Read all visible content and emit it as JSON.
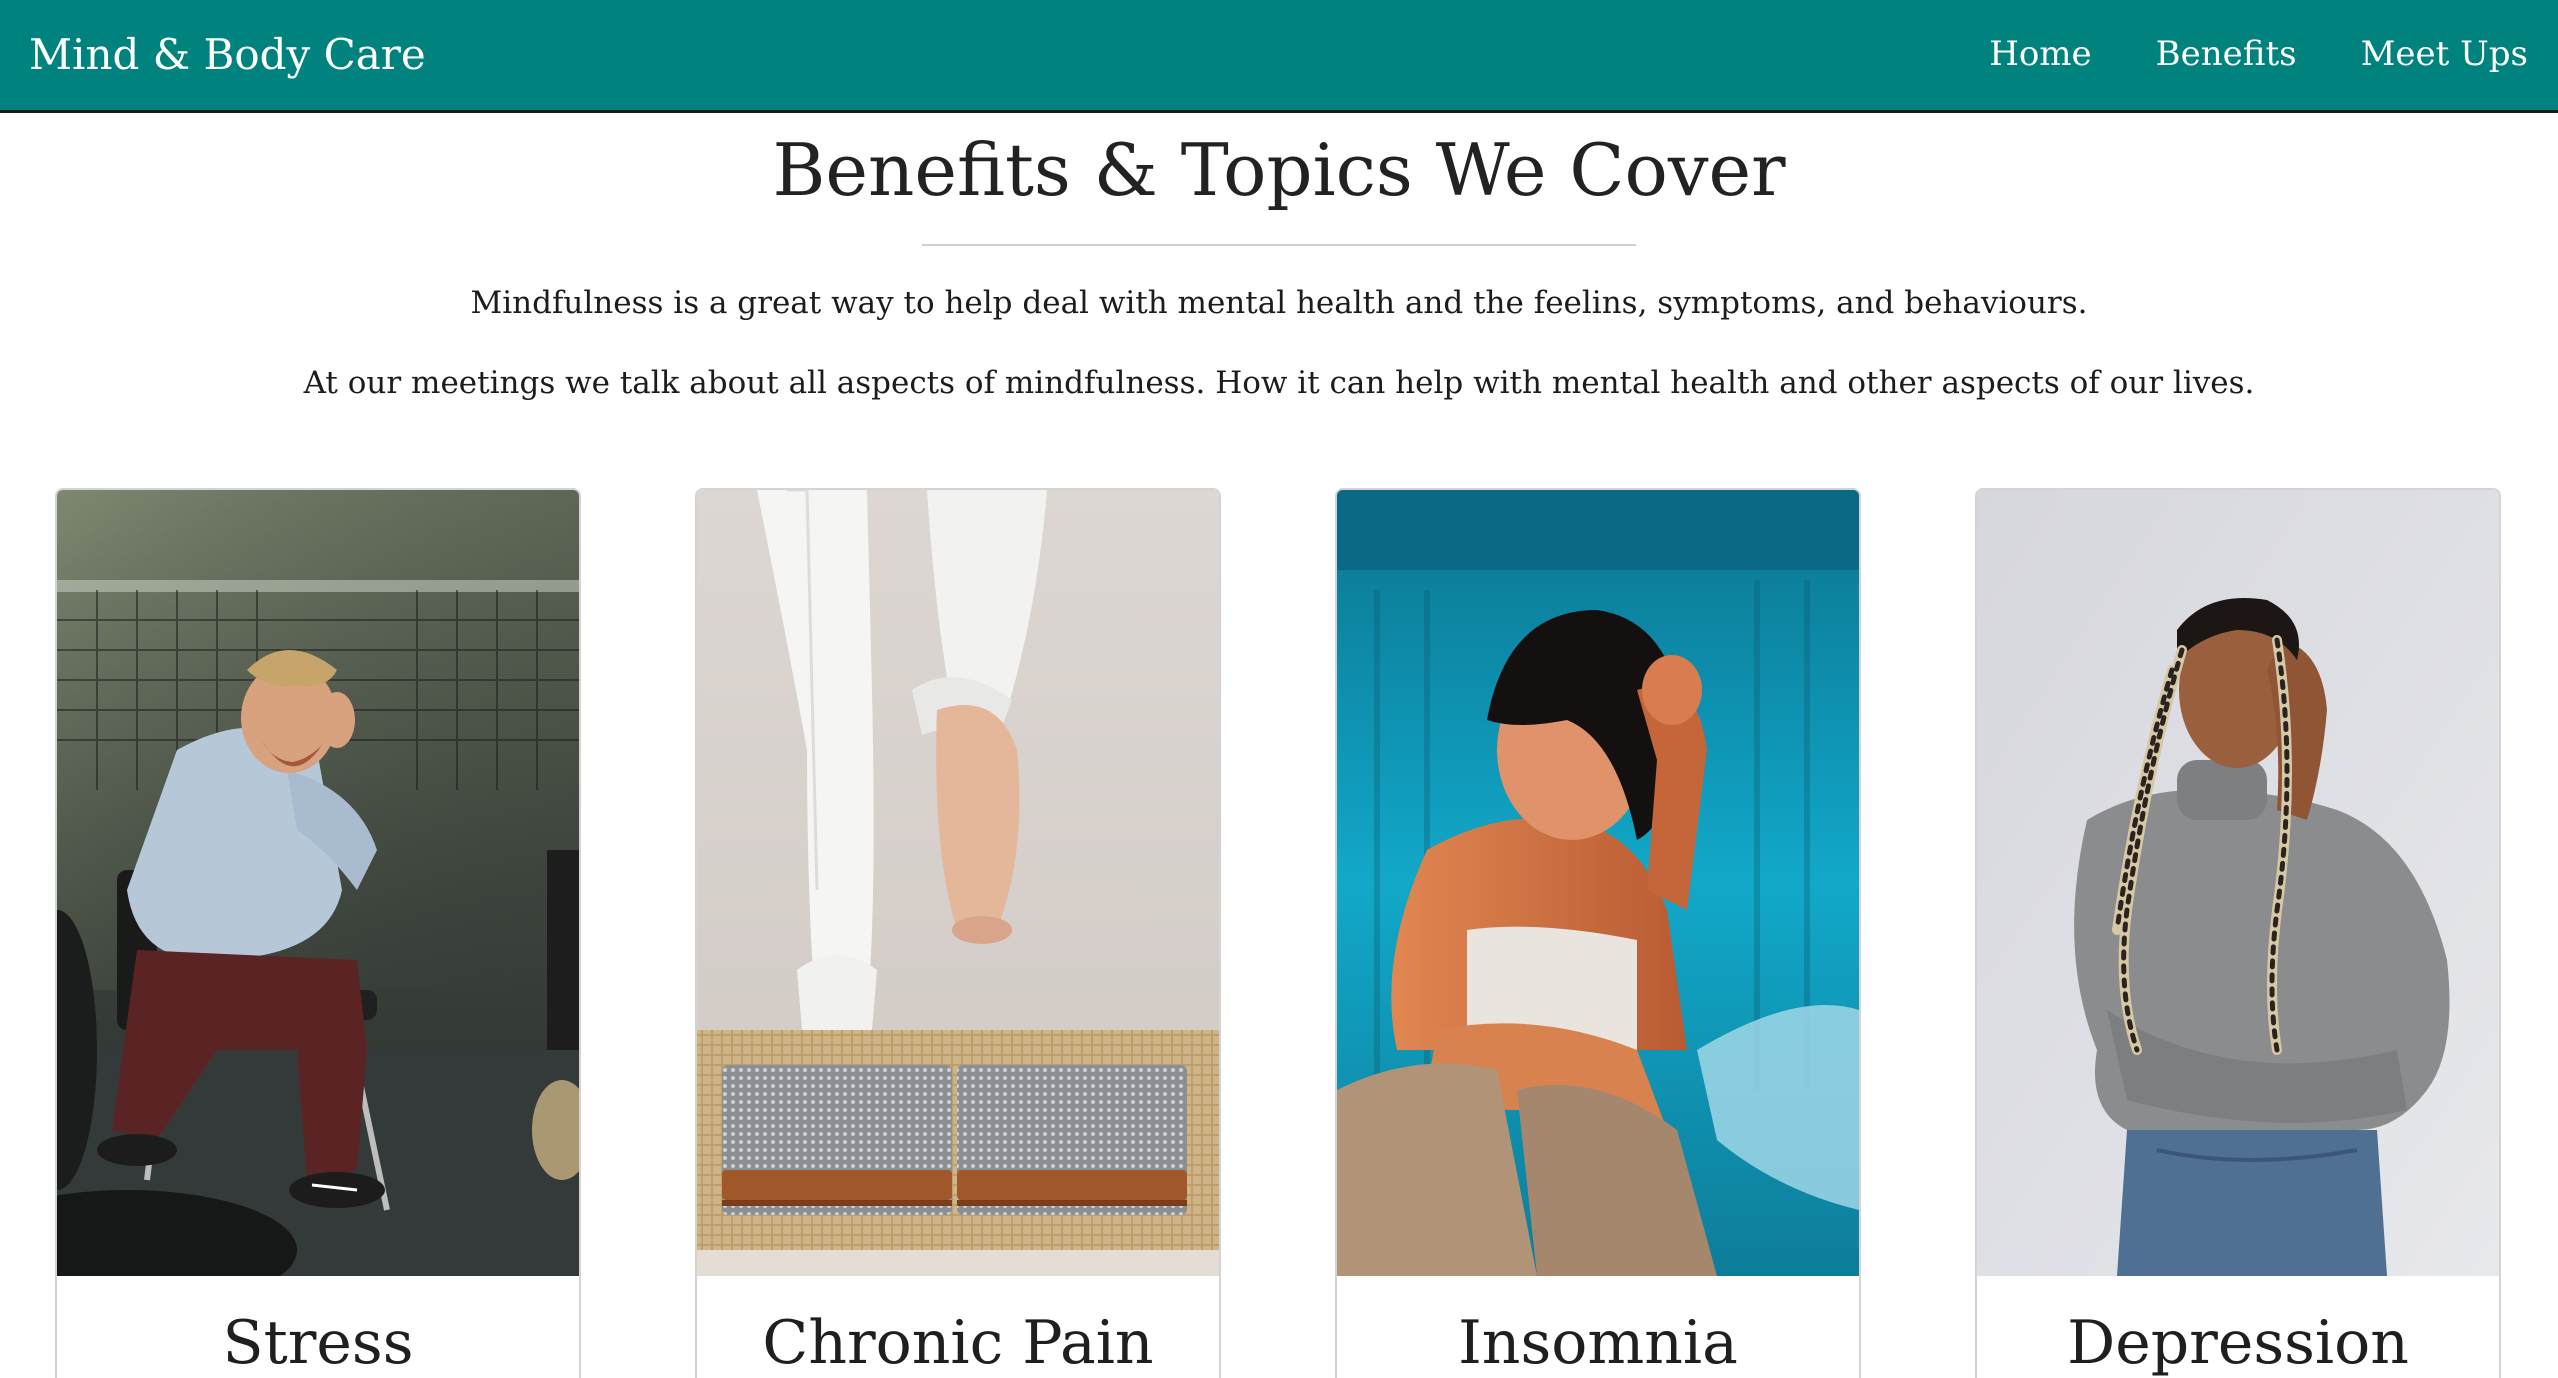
{
  "navbar": {
    "brand": "Mind & Body Care",
    "links": [
      {
        "label": "Home"
      },
      {
        "label": "Benefits"
      },
      {
        "label": "Meet Ups"
      }
    ],
    "background_color": "#00837f"
  },
  "benefits": {
    "title": "Benefits & Topics We Cover",
    "paragraphs": [
      "Mindfulness is a great way to help deal with mental health and the feelins, symptoms, and behaviours.",
      "At our meetings we talk about all aspects of mindfulness. How it can help with mental health and other aspects of our lives."
    ],
    "cards": [
      {
        "title": "Stress",
        "image_icon": "stressed-man-photo"
      },
      {
        "title": "Chronic Pain",
        "image_icon": "acupressure-mat-photo"
      },
      {
        "title": "Insomnia",
        "image_icon": "tired-woman-photo"
      },
      {
        "title": "Depression",
        "image_icon": "distressed-woman-photo"
      }
    ]
  }
}
